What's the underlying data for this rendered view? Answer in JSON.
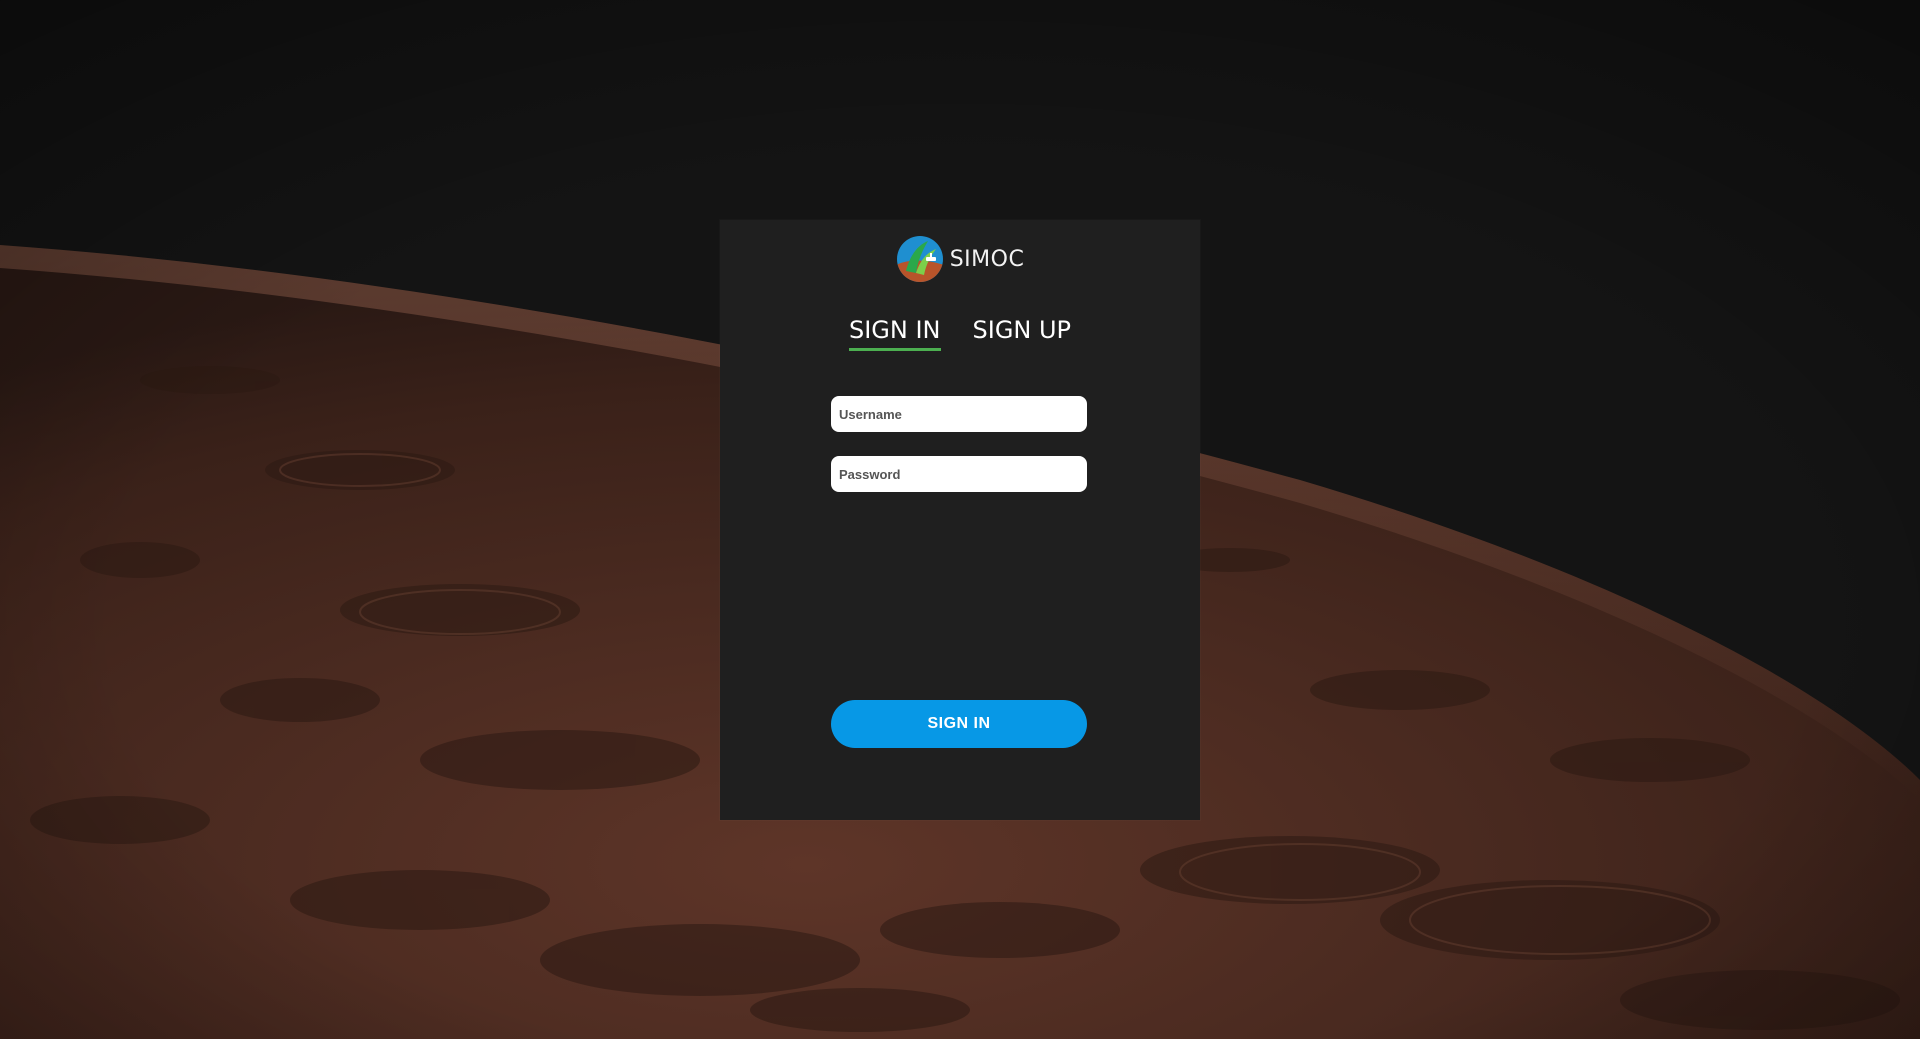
{
  "app": {
    "name": "SIMOC",
    "logo_icon": "simoc-logo-icon"
  },
  "tabs": [
    {
      "label": "SIGN IN",
      "active": true
    },
    {
      "label": "SIGN UP",
      "active": false
    }
  ],
  "form": {
    "username": {
      "placeholder": "Username",
      "value": ""
    },
    "password": {
      "placeholder": "Password",
      "value": ""
    },
    "submit_label": "SIGN IN"
  },
  "colors": {
    "background": "#141414",
    "card": "#1f1f1f",
    "active_tab_underline": "#4caf50",
    "primary_button": "#0798e6",
    "planet_surface": "#6b3b2c"
  }
}
